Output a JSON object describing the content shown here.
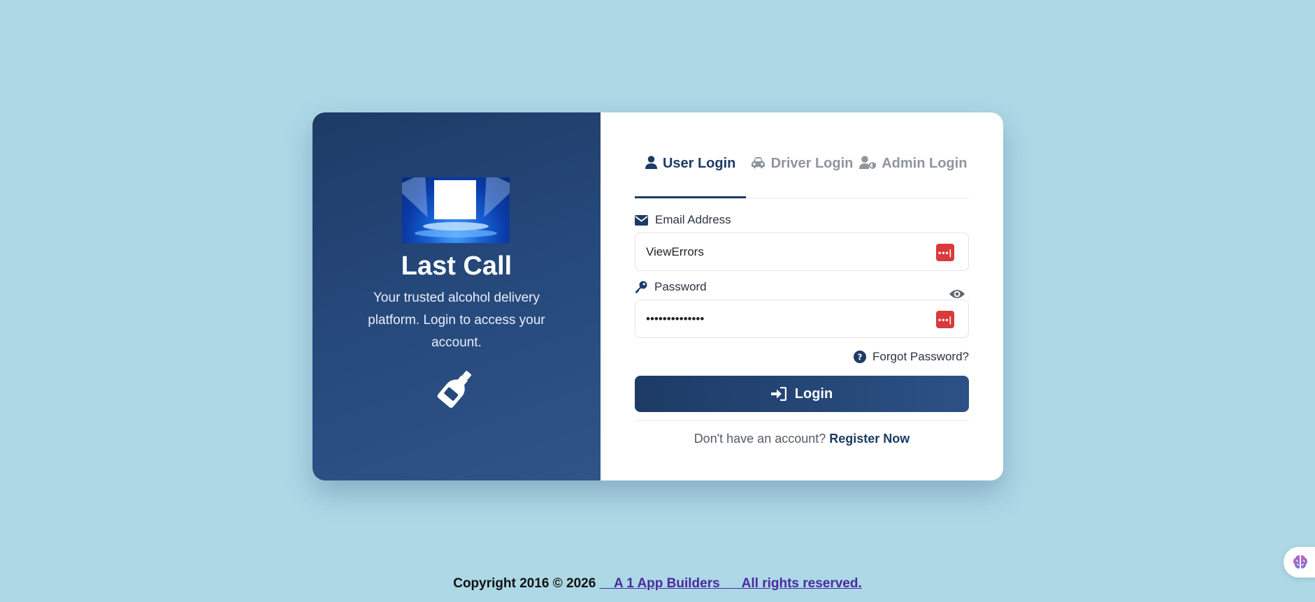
{
  "brand": {
    "title": "Last Call",
    "description": "Your trusted alcohol delivery platform. Login to access your account."
  },
  "tabs": [
    {
      "label": "User Login",
      "icon": "user-icon",
      "active": true
    },
    {
      "label": "Driver Login",
      "icon": "car-icon",
      "active": false
    },
    {
      "label": "Admin Login",
      "icon": "user-shield-icon",
      "active": false
    }
  ],
  "email": {
    "label": "Email Address",
    "value": "ViewErrors"
  },
  "password": {
    "label": "Password",
    "value": "••••••••••••••"
  },
  "forgot_password": "Forgot Password?",
  "login_button": "Login",
  "register": {
    "prompt": "Don't have an account?",
    "link": "Register Now"
  },
  "footer": {
    "copyright": "Copyright 2016 © 2026",
    "link": "    A 1 App Builders      All rights reserved."
  },
  "colors": {
    "background": "#add8e6",
    "primary": "#1d3b66",
    "password_manager_badge": "#d93a3a"
  }
}
